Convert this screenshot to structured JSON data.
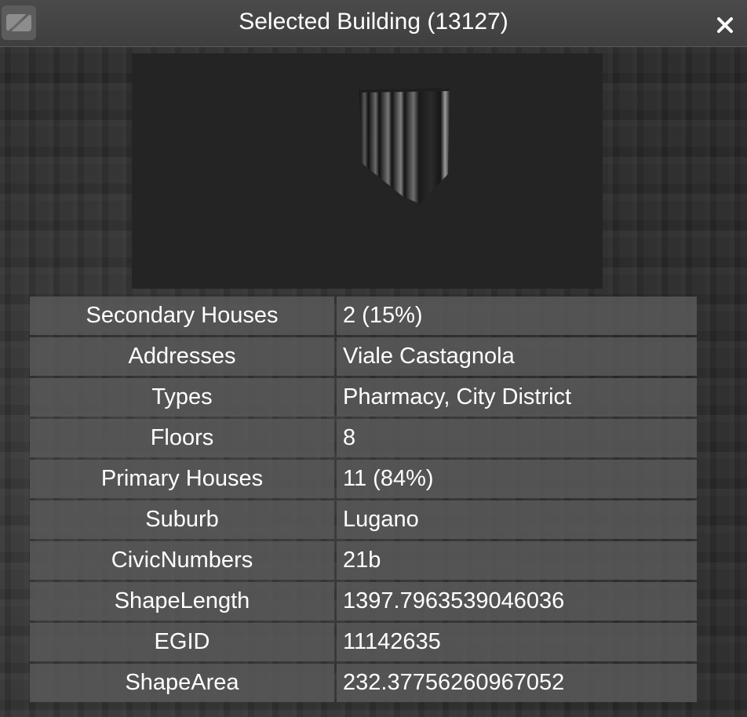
{
  "window": {
    "title": "Selected Building (13127)"
  },
  "icons": {
    "toggle": "visibility-off-icon",
    "close": "close-icon"
  },
  "properties": [
    {
      "key": "Secondary Houses",
      "value": "2 (15%)"
    },
    {
      "key": "Addresses",
      "value": "Viale Castagnola"
    },
    {
      "key": "Types",
      "value": "Pharmacy, City District"
    },
    {
      "key": "Floors",
      "value": "8"
    },
    {
      "key": "Primary Houses",
      "value": "11 (84%)"
    },
    {
      "key": "Suburb",
      "value": "Lugano"
    },
    {
      "key": "CivicNumbers",
      "value": "21b"
    },
    {
      "key": "ShapeLength",
      "value": "1397.7963539046036"
    },
    {
      "key": "EGID",
      "value": "11142635"
    },
    {
      "key": "ShapeArea",
      "value": "232.37756260967052"
    }
  ]
}
